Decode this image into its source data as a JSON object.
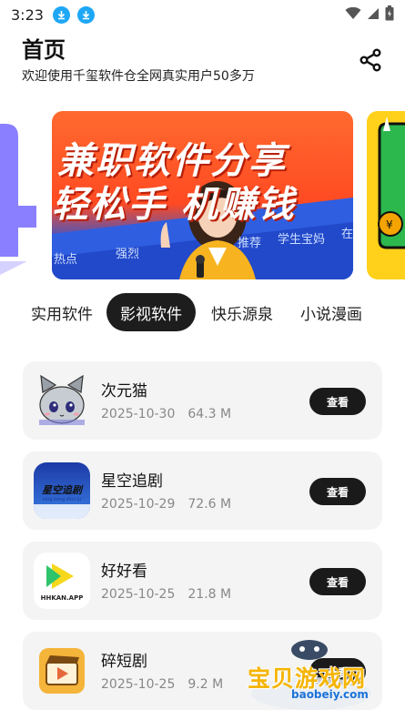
{
  "status_bar": {
    "time": "3:23",
    "icons": [
      "download-icon",
      "download-icon",
      "wifi-icon",
      "signal-icon",
      "battery-icon"
    ]
  },
  "header": {
    "title": "首页",
    "subtitle": "欢迎使用千玺软件仓全网真实用户50多万",
    "share_icon": "share-icon"
  },
  "banner": {
    "line1": "兼职软件分享",
    "line2": "轻松手  机赚钱",
    "tags": [
      "热点",
      "强烈",
      "推荐",
      "学生宝妈",
      "在"
    ]
  },
  "tabs": [
    {
      "label": "实用软件",
      "active": false
    },
    {
      "label": "影视软件",
      "active": true
    },
    {
      "label": "快乐源泉",
      "active": false
    },
    {
      "label": "小说漫画",
      "active": false
    }
  ],
  "apps": [
    {
      "name": "次元猫",
      "date": "2025-10-30",
      "size": "64.3 M",
      "button": "查看",
      "icon": "cat-mascot-icon"
    },
    {
      "name": "星空追剧",
      "date": "2025-10-29",
      "size": "72.6 M",
      "button": "查看",
      "icon": "xingkong-logo-icon",
      "icon_text": "星空追剧",
      "icon_subtext": "xing kong zhui ju"
    },
    {
      "name": "好好看",
      "date": "2025-10-25",
      "size": "21.8 M",
      "button": "查看",
      "icon": "hhkan-logo-icon",
      "icon_text": "HHKAN.APP"
    },
    {
      "name": "碎短剧",
      "date": "2025-10-25",
      "size": "9.2 M",
      "button": "查看",
      "icon": "clapper-play-icon"
    }
  ],
  "watermark": {
    "text": "宝贝游戏网",
    "url": "baobeiy.com"
  },
  "colors": {
    "accent_dark": "#1d1d1d",
    "download_badge": "#1ea7f5",
    "card_bg": "#f4f4f4"
  }
}
